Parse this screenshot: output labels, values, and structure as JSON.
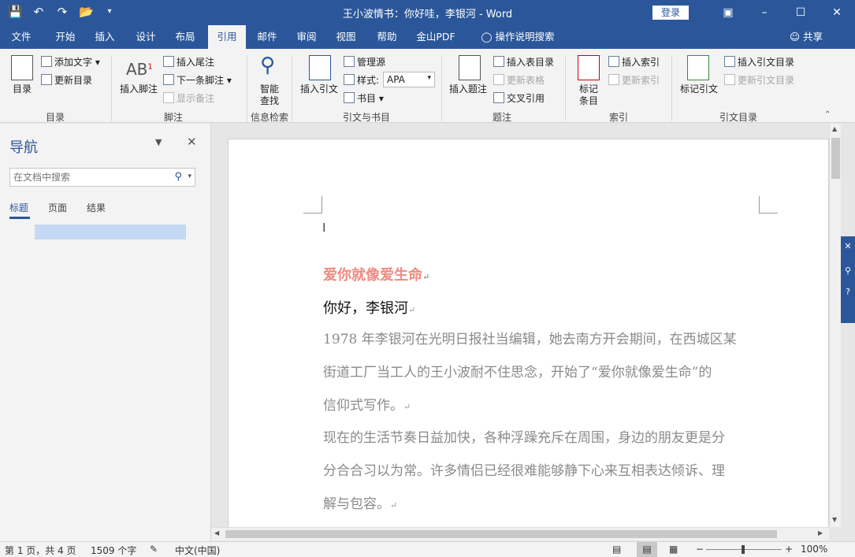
{
  "window": {
    "title": "王小波情书：你好哇，李银河  -  Word",
    "login_label": "登录",
    "controls": [
      "ribbon-display-icon",
      "minimize-icon",
      "maximize-icon",
      "close-icon"
    ]
  },
  "quick_access": [
    "save-icon",
    "undo-icon",
    "redo-icon",
    "open-icon",
    "customize-icon"
  ],
  "tabs": [
    {
      "label": "文件"
    },
    {
      "label": "开始"
    },
    {
      "label": "插入"
    },
    {
      "label": "设计"
    },
    {
      "label": "布局"
    },
    {
      "label": "引用",
      "active": true
    },
    {
      "label": "邮件"
    },
    {
      "label": "审阅"
    },
    {
      "label": "视图"
    },
    {
      "label": "帮助"
    },
    {
      "label": "金山PDF"
    }
  ],
  "tell_me": "操作说明搜索",
  "share_label": "共享",
  "ribbon": {
    "toc": {
      "big": "目录",
      "add_text": "添加文字",
      "update": "更新目录",
      "group": "目录"
    },
    "footnotes": {
      "insert_footnote": "插入脚注",
      "insert_endnote": "插入尾注",
      "next_footnote": "下一条脚注",
      "show_notes": "显示备注",
      "group": "脚注"
    },
    "research": {
      "smart_lookup_1": "智能",
      "smart_lookup_2": "查找",
      "group": "信息检索"
    },
    "citations": {
      "insert_citation": "插入引文",
      "manage_sources": "管理源",
      "style_label": "样式:",
      "style_value": "APA",
      "bibliography": "书目",
      "group": "引文与书目"
    },
    "captions": {
      "insert_caption": "插入题注",
      "insert_tof": "插入表目录",
      "update_table": "更新表格",
      "cross_ref": "交叉引用",
      "group": "题注"
    },
    "index": {
      "mark_entry_1": "标记",
      "mark_entry_2": "条目",
      "insert_index": "插入索引",
      "update_index": "更新索引",
      "group": "索引"
    },
    "toa": {
      "mark_citation": "标记引文",
      "insert_toa": "插入引文目录",
      "update_toa": "更新引文目录",
      "group": "引文目录"
    }
  },
  "nav": {
    "title": "导航",
    "search_placeholder": "在文档中搜索",
    "tabs": [
      "标题",
      "页面",
      "结果"
    ]
  },
  "document": {
    "heading": "爱你就像爱生命",
    "greeting": "你好，李银河",
    "para1_l1": "1978 年李银河在光明日报社当编辑，她去南方开会期间，在西城区某",
    "para1_l2": "街道工厂当工人的王小波耐不住思念，开始了“爱你就像爱生命”的",
    "para1_l3": "信仰式写作。",
    "para2_l1": "现在的生活节奏日益加快，各种浮躁充斥在周围，身边的朋友更是分",
    "para2_l2": "分合合习以为常。许多情侣已经很难能够静下心来互相表达倾诉、理",
    "para2_l3": "解与包容。",
    "para_mark": "↵"
  },
  "status": {
    "page": "第 1 页，共 4 页",
    "words": "1509 个字",
    "language": "中文(中国)",
    "zoom": "100%"
  },
  "colors": {
    "brand": "#2b579a",
    "heading": "#f08a80"
  }
}
